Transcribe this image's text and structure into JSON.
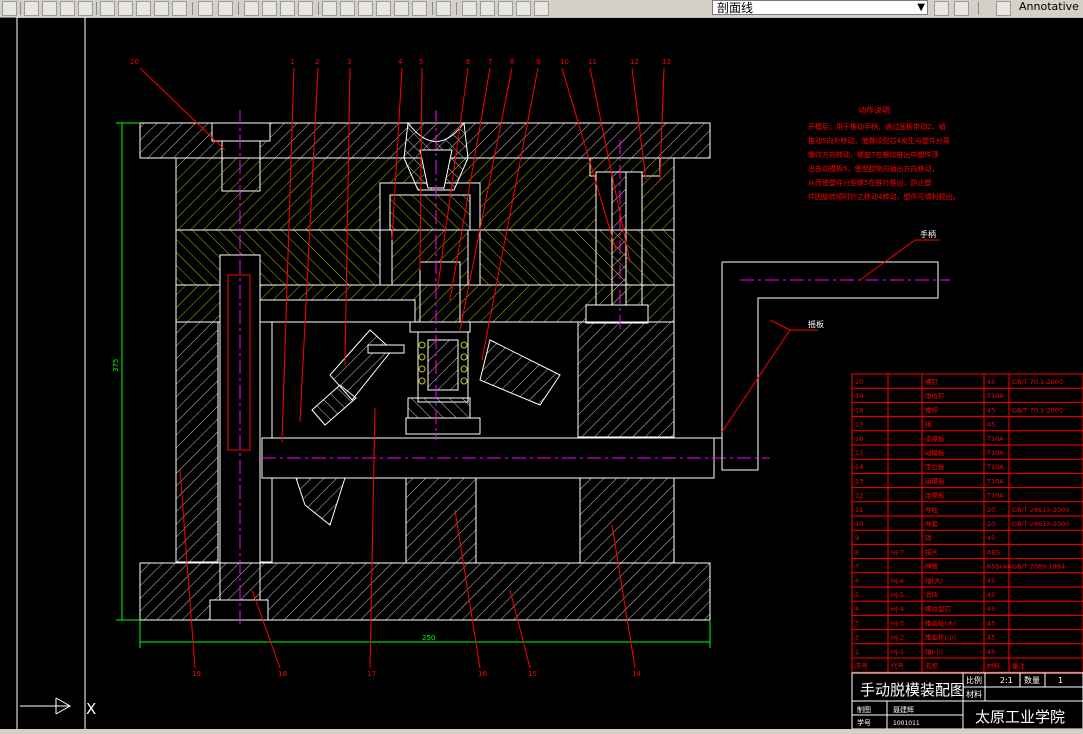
{
  "toolbar": {
    "layer_dropdown_value": "剖面线",
    "annotation_scale_label": "Annotative"
  },
  "drawing": {
    "notes_title": "动作说明",
    "notes_lines": [
      "开模后，用于推动手柄，通过面板带动2、销",
      "推动5向外移动，使螺纹型芯4发生与塑件分离",
      "螺纹方向转动，螺旋7在螺纹推出中塑件顶",
      "出由动模板5，使型腔侧向抽出方向移动，",
      "从而使塑件分型螺5在推针推出，防止塑",
      "件因旋转顺时针之移动4转动，塑件可顺利脱出。"
    ],
    "handle_label": "手柄",
    "link_label": "摇板",
    "balloons_top": [
      "20",
      "1",
      "2",
      "3",
      "4",
      "5",
      "6",
      "7",
      "8",
      "9",
      "10",
      "11",
      "12",
      "13"
    ],
    "balloons_bottom": [
      "19",
      "18",
      "17",
      "16",
      "15",
      "14"
    ],
    "dim_height": "375",
    "dim_width": "250"
  },
  "bom": {
    "rows": [
      [
        "20",
        "",
        "螺钉",
        "45",
        "GB/T 70.1-2000"
      ],
      [
        "19",
        "",
        "限位钉",
        "T10A",
        ""
      ],
      [
        "18",
        "",
        "推杆",
        "45",
        "GB/T 70.1-2000"
      ],
      [
        "17",
        "",
        "销",
        "45",
        ""
      ],
      [
        "16",
        "",
        "支撑板",
        "T10A",
        ""
      ],
      [
        "15",
        "",
        "动模板",
        "T10A",
        ""
      ],
      [
        "14",
        "",
        "定位板",
        "T10A",
        ""
      ],
      [
        "13",
        "",
        "固模板",
        "T10A",
        ""
      ],
      [
        "12",
        "",
        "定模板",
        "T10A",
        ""
      ],
      [
        "11",
        "",
        "导柱",
        "20",
        "GB/T 28613-2000"
      ],
      [
        "10",
        "",
        "导套",
        "20",
        "GB/T 28613-2000"
      ],
      [
        "9",
        "",
        "销",
        "45",
        ""
      ],
      [
        "8",
        "HJ-7",
        "拨片",
        "ABS",
        ""
      ],
      [
        "7",
        "",
        "弹簧",
        "65Si-VA",
        "GB/T 2089-1994"
      ],
      [
        "6",
        "HJ-6",
        "轴(大)",
        "45",
        ""
      ],
      [
        "5",
        "HJ-5",
        "滑块",
        "45",
        ""
      ],
      [
        "4",
        "HJ-4",
        "螺纹型芯",
        "45",
        ""
      ],
      [
        "3",
        "HJ-3",
        "锥齿轮(大)",
        "45",
        ""
      ],
      [
        "2",
        "HJ-2",
        "锥齿轮(小)",
        "45",
        ""
      ],
      [
        "1",
        "HJ-1",
        "轴(小)",
        "45",
        ""
      ]
    ],
    "header": [
      "序号",
      "代号",
      "名称",
      "材料",
      "备注"
    ]
  },
  "title_block": {
    "drawing_title": "手动脱模装配图",
    "scale_label": "比例",
    "scale_value": "2:1",
    "qty_label": "数量",
    "qty_value": "1",
    "material_label": "材料",
    "drawn_label": "制图",
    "drawn_value": "聂建辉",
    "student_label": "学号",
    "student_value": "1001011",
    "school": "太原工业学院"
  },
  "colors": {
    "background": "#000000",
    "outline": "#ffffff",
    "hatch": "#c8c800",
    "leader": "#ff0000",
    "centerline": "#ff00ff",
    "dimension": "#00ff00",
    "table": "#ff0000",
    "cyan": "#00ffff"
  },
  "ucs_label": "X"
}
